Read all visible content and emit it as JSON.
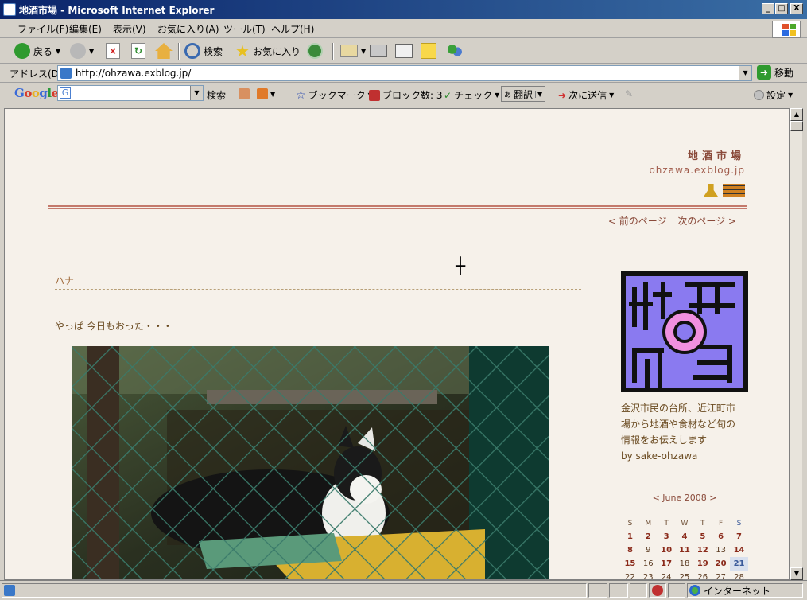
{
  "window": {
    "title": "地酒市場 - Microsoft Internet Explorer",
    "minimize": "_",
    "maximize": "□",
    "close": "X"
  },
  "menu": [
    "ファイル(F)",
    "編集(E)",
    "表示(V)",
    "お気に入り(A)",
    "ツール(T)",
    "ヘルプ(H)"
  ],
  "toolbar": {
    "back": "戻る",
    "search": "検索",
    "favorites": "お気に入り"
  },
  "address": {
    "label": "アドレス(D)",
    "url": "http://ohzawa.exblog.jp/",
    "go": "移動"
  },
  "google_toolbar": {
    "logo": "Google",
    "search_button": "検索",
    "bookmarks": "ブックマーク",
    "blocked": "ブロック数: 3",
    "check": "チェック",
    "translate": "翻訳",
    "send_to": "次に送信",
    "settings": "設定"
  },
  "page": {
    "site_title": "地酒市場",
    "site_url": "ohzawa.exblog.jp",
    "prev_page": "< 前のページ",
    "next_page": "次のページ >",
    "post_title": "ハナ",
    "post_text": "やっぱ 今日もおった・・・",
    "profile_lines": [
      "金沢市民の台所、近江町市",
      "場から地酒や食材など旬の",
      "情報をお伝えします",
      "by sake-ohzawa"
    ],
    "calendar": {
      "title": "< June 2008 >",
      "headers": [
        "S",
        "M",
        "T",
        "W",
        "T",
        "F",
        "S"
      ],
      "rows": [
        [
          "1",
          "2",
          "3",
          "4",
          "5",
          "6",
          "7"
        ],
        [
          "8",
          "9",
          "10",
          "11",
          "12",
          "13",
          "14"
        ],
        [
          "15",
          "16",
          "17",
          "18",
          "19",
          "20",
          "21"
        ],
        [
          "22",
          "23",
          "24",
          "25",
          "26",
          "27",
          "28"
        ]
      ]
    }
  },
  "status": {
    "zone": "インターネット"
  }
}
